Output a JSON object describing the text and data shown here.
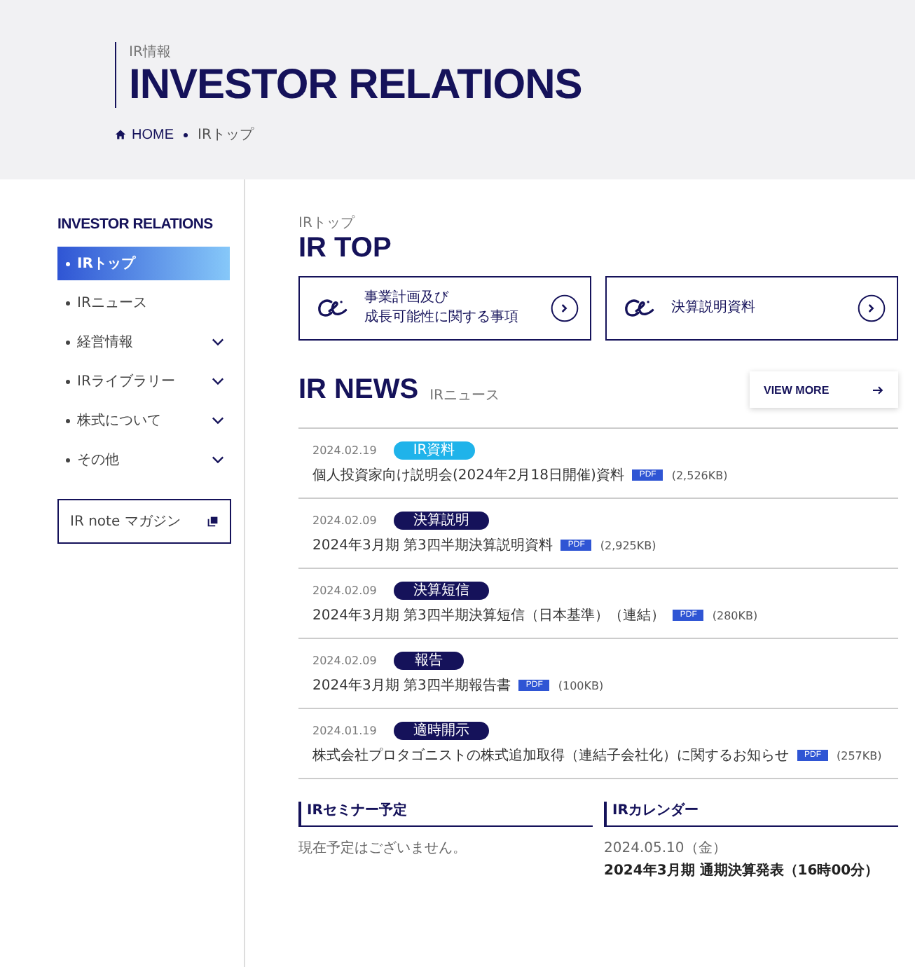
{
  "header": {
    "eyebrow": "IR情報",
    "title": "INVESTOR RELATIONS",
    "breadcrumb": [
      "HOME",
      "IRトップ"
    ]
  },
  "sidebar": {
    "title": "INVESTOR RELATIONS",
    "items": [
      {
        "label": "IRトップ",
        "selected": true,
        "expandable": false
      },
      {
        "label": "IRニュース",
        "selected": false,
        "expandable": false
      },
      {
        "label": "経営情報",
        "selected": false,
        "expandable": true
      },
      {
        "label": "IRライブラリー",
        "selected": false,
        "expandable": true
      },
      {
        "label": "株式について",
        "selected": false,
        "expandable": true
      },
      {
        "label": "その他",
        "selected": false,
        "expandable": true
      }
    ],
    "note_button": "IR note マガジン"
  },
  "main": {
    "eyebrow": "IRトップ",
    "title": "IR TOP",
    "cards": [
      {
        "lines": [
          "事業計画及び",
          "成長可能性に関する事項"
        ]
      },
      {
        "lines": [
          "決算説明資料"
        ]
      }
    ],
    "news": {
      "title": "IR NEWS",
      "subtitle": "IRニュース",
      "view_more": "VIEW MORE",
      "items": [
        {
          "date": "2024.02.19",
          "tag": "IR資料",
          "color": "#1fb3ea",
          "title": "個人投資家向け説明会(2024年2月18日開催)資料",
          "file": "PDF",
          "size": "(2,526KB)"
        },
        {
          "date": "2024.02.09",
          "tag": "決算説明",
          "color": "#15125a",
          "title": "2024年3月期 第3四半期決算説明資料",
          "file": "PDF",
          "size": "(2,925KB)"
        },
        {
          "date": "2024.02.09",
          "tag": "決算短信",
          "color": "#15125a",
          "title": "2024年3月期 第3四半期決算短信（日本基準）（連結）",
          "file": "PDF",
          "size": "(280KB)"
        },
        {
          "date": "2024.02.09",
          "tag": "報告",
          "color": "#15125a",
          "title": "2024年3月期 第3四半期報告書",
          "file": "PDF",
          "size": "(100KB)"
        },
        {
          "date": "2024.01.19",
          "tag": "適時開示",
          "color": "#15125a",
          "title": "株式会社プロタゴニストの株式追加取得（連結子会社化）に関するお知らせ",
          "file": "PDF",
          "size": "(257KB)"
        }
      ]
    },
    "seminar": {
      "title": "IRセミナー予定",
      "text": "現在予定はございません。"
    },
    "calendar": {
      "title": "IRカレンダー",
      "date": "2024.05.10（金）",
      "event": "2024年3月期 通期決算発表（16時00分）"
    }
  }
}
